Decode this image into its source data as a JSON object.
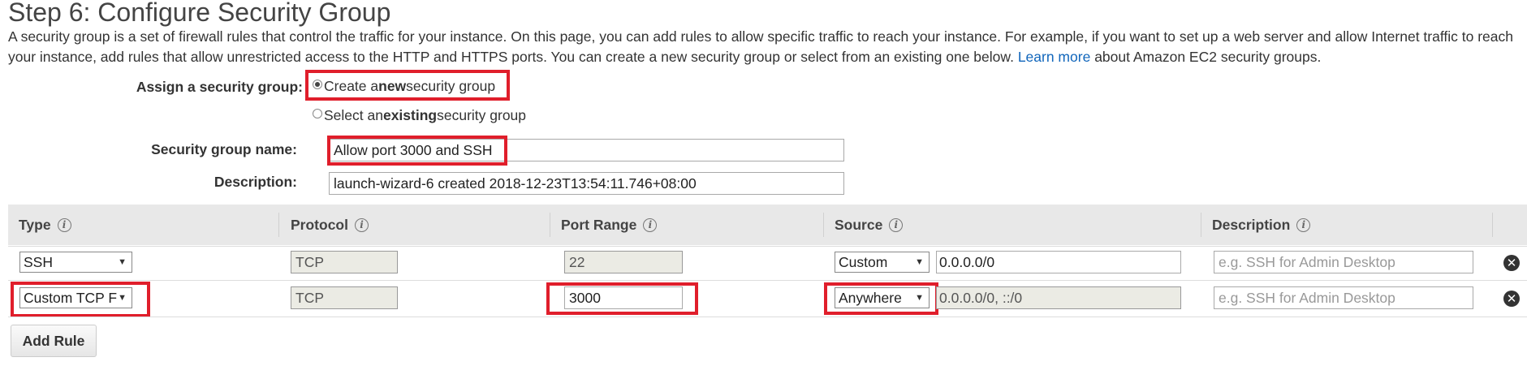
{
  "page": {
    "title": "Step 6: Configure Security Group",
    "intro_text": "A security group is a set of firewall rules that control the traffic for your instance. On this page, you can add rules to allow specific traffic to reach your instance. For example, if you want to set up a web server and allow Internet traffic to reach your instance, add rules that allow unrestricted access to the HTTP and HTTPS ports. You can create a new security group or select from an existing one below.",
    "learn_more_link": "Learn more",
    "intro_suffix": "about Amazon EC2 security groups."
  },
  "assign": {
    "label": "Assign a security group:",
    "option_new_pre": "Create a ",
    "option_new_bold": "new",
    "option_new_post": " security group",
    "option_existing_pre": "Select an ",
    "option_existing_bold": "existing",
    "option_existing_post": " security group",
    "selected": "new"
  },
  "form": {
    "name_label": "Security group name:",
    "name_value": "Allow port 3000 and SSH",
    "description_label": "Description:",
    "description_value": "launch-wizard-6 created 2018-12-23T13:54:11.746+08:00"
  },
  "table": {
    "headers": {
      "type": "Type",
      "protocol": "Protocol",
      "port_range": "Port Range",
      "source": "Source",
      "description": "Description"
    },
    "info_icon_glyph": "i",
    "rows": [
      {
        "type": "SSH",
        "protocol": "TCP",
        "port_range": "22",
        "source_type": "Custom",
        "source_value": "0.0.0.0/0",
        "description_placeholder": "e.g. SSH for Admin Desktop"
      },
      {
        "type": "Custom TCP F",
        "protocol": "TCP",
        "port_range": "3000",
        "source_type": "Anywhere",
        "source_value": "0.0.0.0/0, ::/0",
        "description_placeholder": "e.g. SSH for Admin Desktop"
      }
    ],
    "delete_glyph": "✕"
  },
  "actions": {
    "add_rule_label": "Add Rule"
  },
  "colors": {
    "highlight": "#e01e2b",
    "link": "#1166bb",
    "header_band": "#e8e8e8"
  }
}
